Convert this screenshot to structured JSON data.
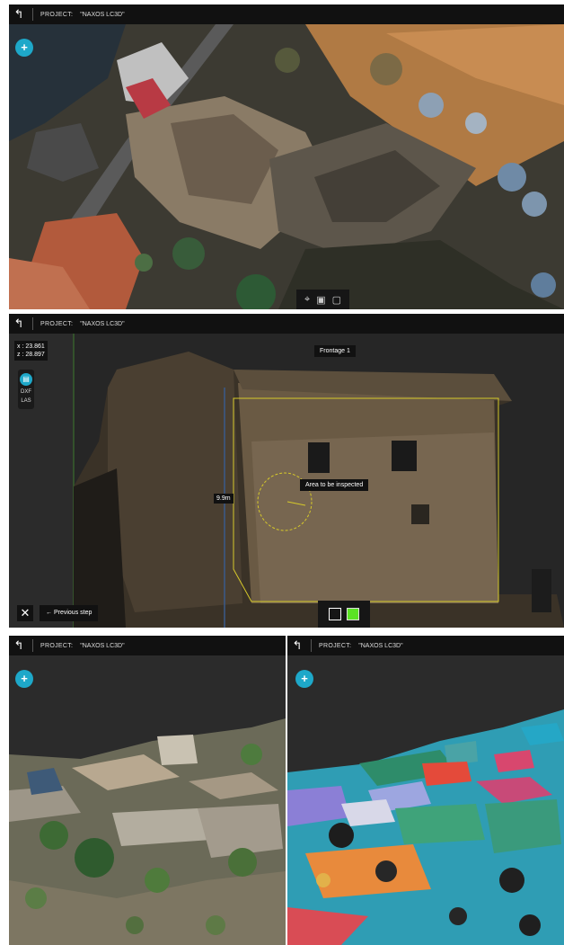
{
  "colors": {
    "accent": "#1ea8c9",
    "topbar": "#111111",
    "frontage_outline": "#d6c92a",
    "selection_cube": "#5be324"
  },
  "header": {
    "back_icon": "back-arrow-icon",
    "project_label": "PROJECT:",
    "project_name": "\"NAXOS LC3D\""
  },
  "panel1": {
    "add_icon": "plus-icon",
    "add_label": "+",
    "view_tools": [
      "target-icon",
      "cube-view-icon",
      "plan-view-icon"
    ]
  },
  "panel2": {
    "coords": {
      "x_label": "x : 23.861",
      "z_label": "z : 28.897"
    },
    "tools": {
      "tool_icon": "document-icon",
      "dxf": "DXF",
      "las": "LAS"
    },
    "frontage_tag": "Frontage 1",
    "annotation_tag": "Area to be inspected",
    "measure_tag": "9.9m",
    "close_label": "✕",
    "prev_label": "Previous step",
    "view_modes": [
      "wireframe-cube-icon",
      "solid-cube-icon"
    ]
  },
  "panel3": {
    "add_label": "+"
  },
  "panel4": {
    "add_label": "+"
  }
}
